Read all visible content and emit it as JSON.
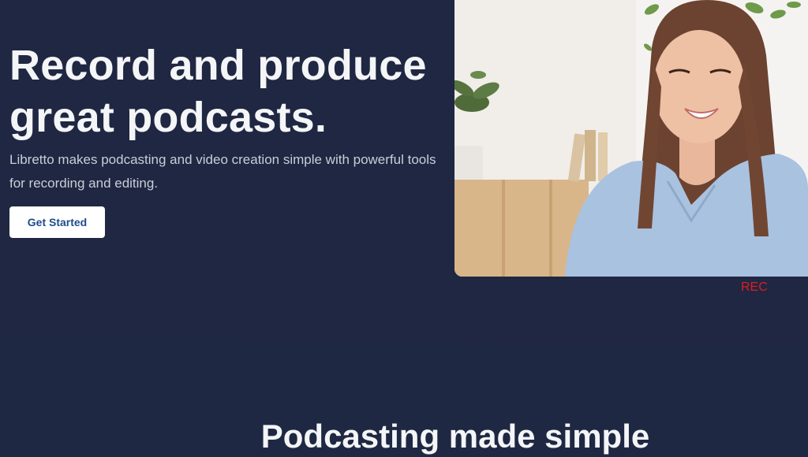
{
  "hero": {
    "title": "Record and produce great podcasts.",
    "subtitle": "Libretto makes podcasting and video creation simple with powerful tools for recording and editing.",
    "cta_label": "Get Started"
  },
  "video": {
    "rec_label": "REC",
    "rec_color": "#e11b22"
  },
  "section": {
    "title": "Podcasting made simple"
  },
  "colors": {
    "background": "#1f2843",
    "cta_text": "#1f4c8c"
  }
}
